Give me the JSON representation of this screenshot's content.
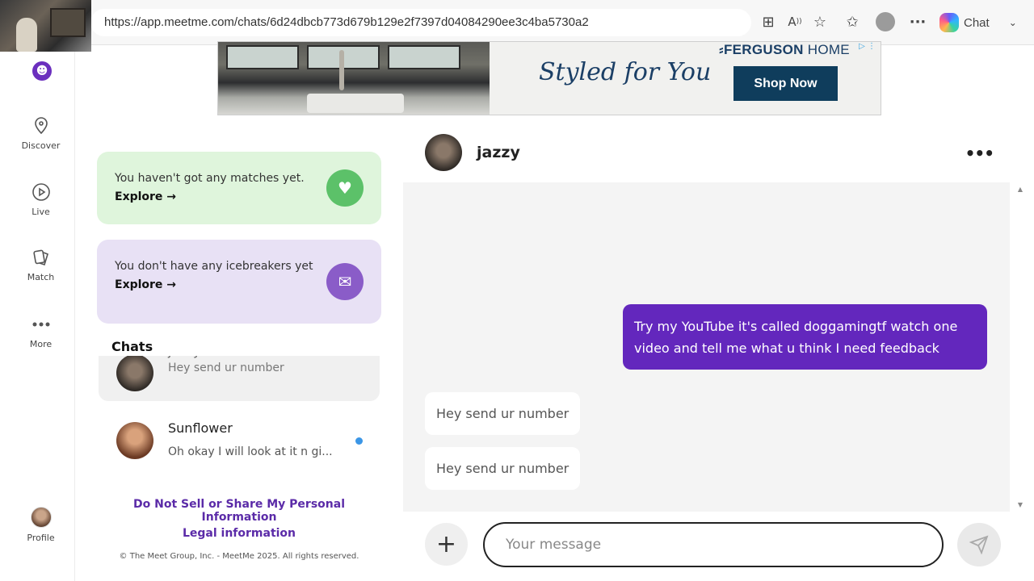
{
  "browser": {
    "url": "https://app.meetme.com/chats/6d24dbcb773d679b129e2f7397d04084290ee3c4ba5730a2",
    "chat_label": "Chat"
  },
  "nav": {
    "items": [
      {
        "label": "Discover",
        "icon": "map-pin-icon"
      },
      {
        "label": "Live",
        "icon": "play-circle-icon"
      },
      {
        "label": "Match",
        "icon": "cards-icon"
      },
      {
        "label": "More",
        "icon": "more-dots-icon"
      },
      {
        "label": "Profile",
        "icon": "avatar"
      }
    ]
  },
  "ad": {
    "tagline": "Styled for You",
    "brand": "FERGUSON",
    "brand_suffix": "HOME",
    "cta": "Shop Now"
  },
  "promos": {
    "matches": {
      "text": "You haven't got any matches yet.",
      "link": "Explore →"
    },
    "icebreakers": {
      "text": "You don't have any icebreakers yet",
      "link": "Explore →"
    }
  },
  "chats": {
    "heading": "Chats",
    "items": [
      {
        "name": "jazzy",
        "preview": "Hey send ur number",
        "unread": false
      },
      {
        "name": "Sunflower",
        "preview": "Oh okay I will look at it n gi...",
        "unread": true
      }
    ]
  },
  "footer": {
    "privacy": "Do Not Sell or Share My Personal Information",
    "legal": "Legal information",
    "copyright": "© The Meet Group, Inc. - MeetMe 2025. All rights reserved."
  },
  "conversation": {
    "name": "jazzy",
    "messages": [
      {
        "direction": "out",
        "text": "Try my YouTube it's called doggamingtf watch one video and tell me what u think I need feedback"
      },
      {
        "direction": "in",
        "text": "Hey send ur number"
      },
      {
        "direction": "in",
        "text": "Hey send ur number"
      }
    ],
    "input_placeholder": "Your message"
  },
  "colors": {
    "brand_purple": "#6327bd",
    "match_green": "#5cc169",
    "icebreaker_purple": "#8a5cc8",
    "unread_blue": "#3b96e6"
  }
}
